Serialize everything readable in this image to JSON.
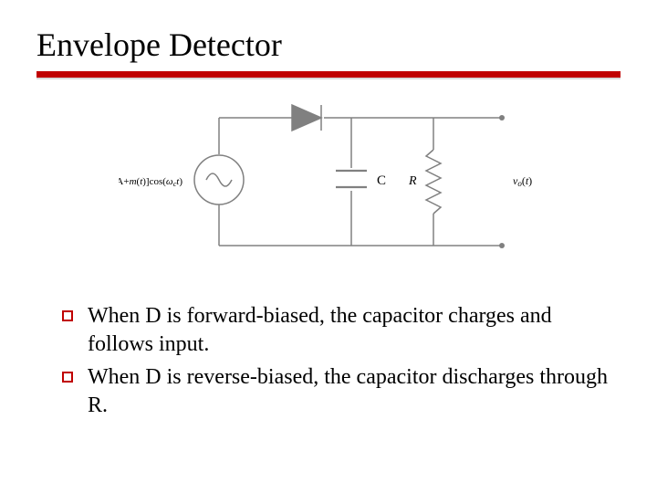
{
  "title": "Envelope Detector",
  "circuit": {
    "source_label_parts": {
      "prefix": "[A+",
      "m": "m",
      "open": "(",
      "t": "t",
      "close": ")]cos(",
      "omega": "ω",
      "sub": "c",
      "t2": "t",
      ")": " )",
      "final": "[A+m(t)]cos(ω_c t)"
    },
    "source_label_plain": "[A+m(t)]cos(ω_c t)",
    "cap_label": "C",
    "res_label": "R",
    "out_label": "v_o(t)"
  },
  "bullets": [
    "When D is forward-biased, the capacitor charges and follows input.",
    "When D is reverse-biased, the capacitor discharges through R."
  ]
}
